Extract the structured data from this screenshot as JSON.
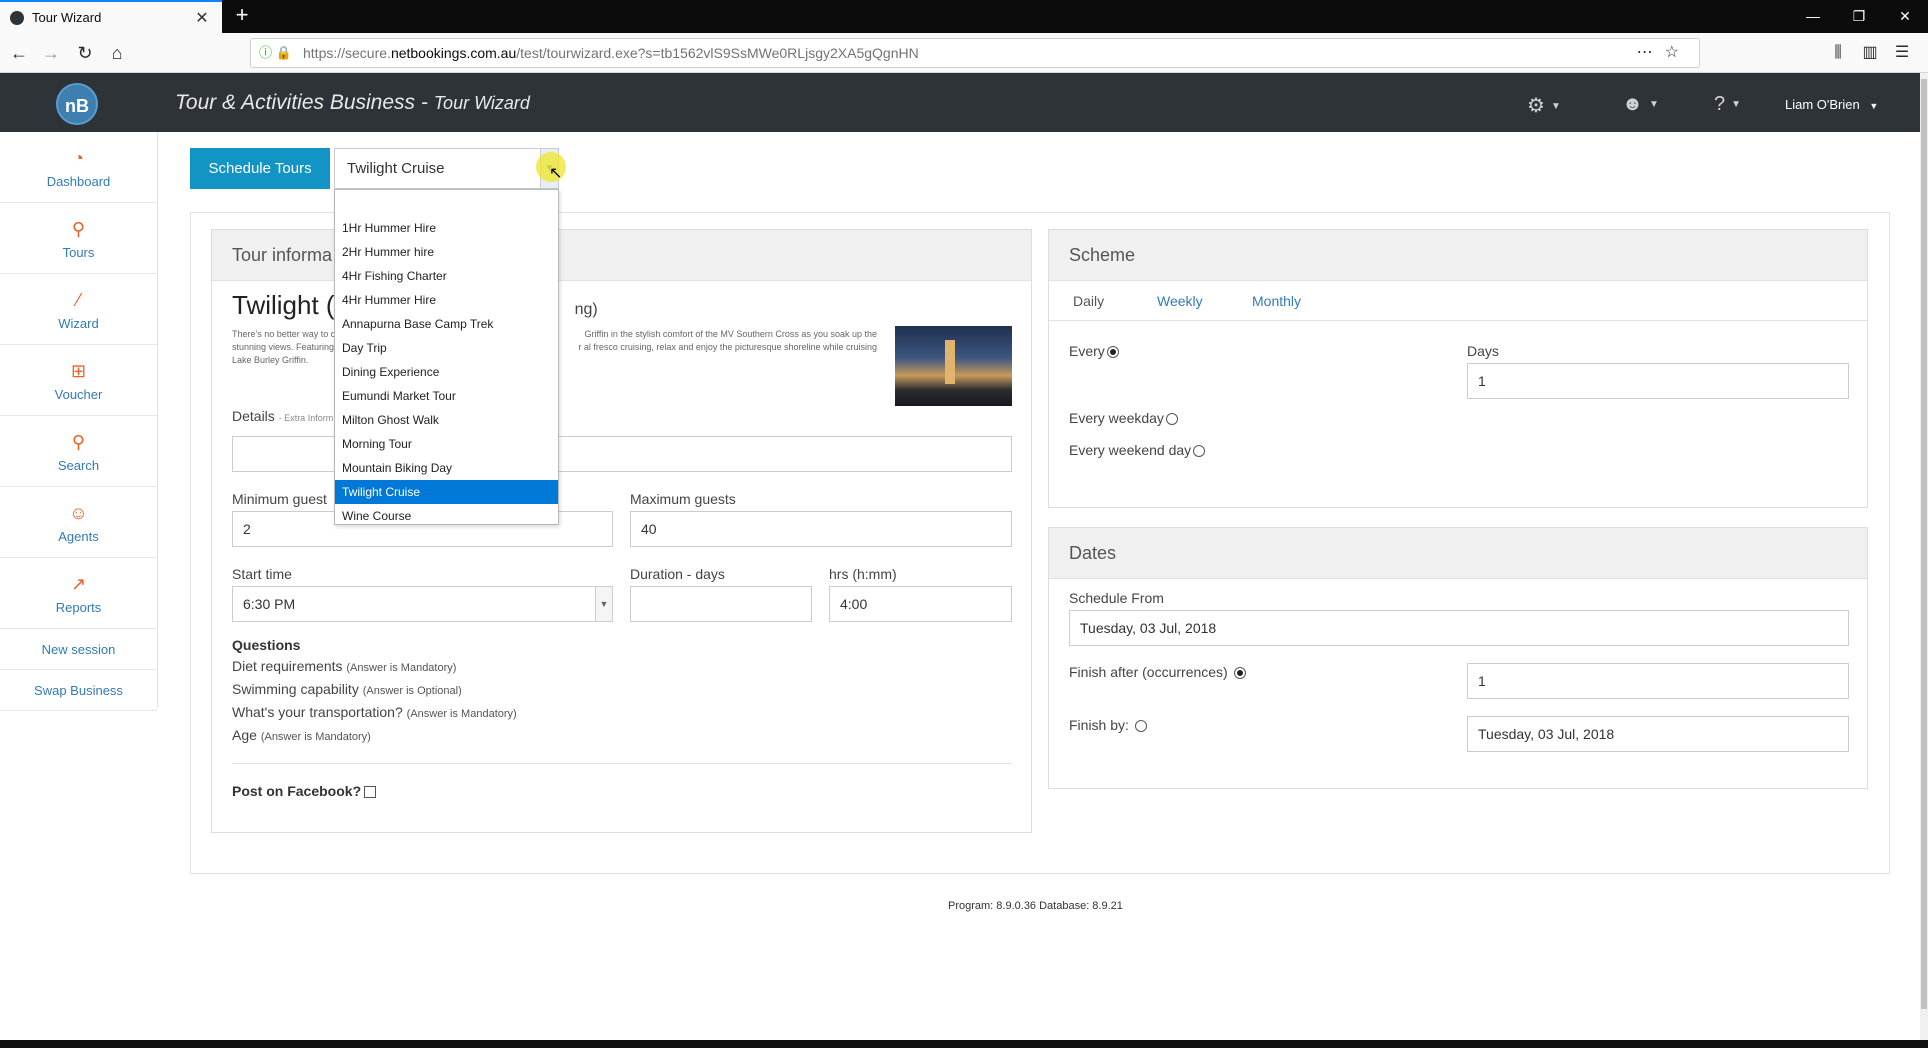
{
  "browser": {
    "tab_title": "Tour Wizard",
    "url_prefix": "https://secure.",
    "url_host": "netbookings.com.au",
    "url_path": "/test/tourwizard.exe?s=tb1562vlS9SsMWe0RLjsgy2XA5gQgnHN"
  },
  "header": {
    "logo": "nB",
    "title": "Tour & Activities Business",
    "subtitle": "Tour Wizard",
    "user_name": "Liam O'Brien"
  },
  "sidebar": {
    "items": [
      {
        "label": "Dashboard",
        "icon": "dashboard-icon"
      },
      {
        "label": "Tours",
        "icon": "tours-icon"
      },
      {
        "label": "Wizard",
        "icon": "wizard-icon"
      },
      {
        "label": "Voucher",
        "icon": "voucher-icon"
      },
      {
        "label": "Search",
        "icon": "search-icon"
      },
      {
        "label": "Agents",
        "icon": "agents-icon"
      },
      {
        "label": "Reports",
        "icon": "reports-icon"
      }
    ],
    "links": [
      "New session",
      "Swap Business"
    ]
  },
  "toolbar": {
    "schedule_label": "Schedule Tours",
    "selected_tour": "Twilight Cruise"
  },
  "dropdown": {
    "options": [
      "1Hr Hummer Hire",
      "2Hr Hummer hire",
      "4Hr Fishing Charter",
      "4Hr Hummer Hire",
      "Annapurna Base Camp Trek",
      "Day Trip",
      "Dining Experience",
      "Eumundi Market Tour",
      "Milton Ghost Walk",
      "Morning Tour",
      "Mountain Biking Day",
      "Twilight Cruise",
      "Wine Course"
    ],
    "selected_index": 11
  },
  "tour": {
    "panel_title": "Tour informa",
    "name_visible": "Twilight (",
    "name_suffix": "ng)",
    "desc_left": "There's no better way to c",
    "desc_left2": "stunning views. Featuring",
    "desc_left3": "Lake Burley Griffin.",
    "desc_right": "Griffin in the stylish comfort of the MV Southern Cross as you soak up the",
    "desc_right2": "r al fresco cruising, relax and enjoy the picturesque shoreline while cruising",
    "details_label": "Details",
    "details_hint": "- Extra Inform",
    "min_guests_label": "Minimum guest",
    "min_guests": "2",
    "max_guests_label": "Maximum guests",
    "max_guests": "40",
    "start_time_label": "Start time",
    "start_time": "6:30 PM",
    "duration_days_label": "Duration - days",
    "duration_days": "",
    "hrs_label": "hrs (h:mm)",
    "hrs": "4:00",
    "questions_title": "Questions",
    "questions": [
      {
        "q": "Diet requirements",
        "note": "(Answer is Mandatory)"
      },
      {
        "q": "Swimming capability",
        "note": "(Answer is Optional)"
      },
      {
        "q": "What's your transportation?",
        "note": "(Answer is Mandatory)"
      },
      {
        "q": "Age",
        "note": "(Answer is Mandatory)"
      }
    ],
    "facebook_label": "Post on Facebook?"
  },
  "scheme": {
    "title": "Scheme",
    "tabs": [
      "Daily",
      "Weekly",
      "Monthly"
    ],
    "active_tab": "Daily",
    "every_label": "Every",
    "days_label": "Days",
    "days_value": "1",
    "weekday_label": "Every weekday",
    "weekend_label": "Every weekend day"
  },
  "dates": {
    "title": "Dates",
    "schedule_from_label": "Schedule From",
    "schedule_from": "Tuesday, 03 Jul, 2018",
    "finish_after_label": "Finish after (occurrences)",
    "finish_after": "1",
    "finish_by_label": "Finish by:",
    "finish_by": "Tuesday, 03 Jul, 2018"
  },
  "footer": {
    "version": "Program: 8.9.0.36 Database: 8.9.21"
  },
  "colors": {
    "header_bg": "#2e3338",
    "accent": "#1294c5",
    "sidebar_icon": "#e8622a",
    "link": "#337ab7",
    "selection": "#0078d7"
  }
}
